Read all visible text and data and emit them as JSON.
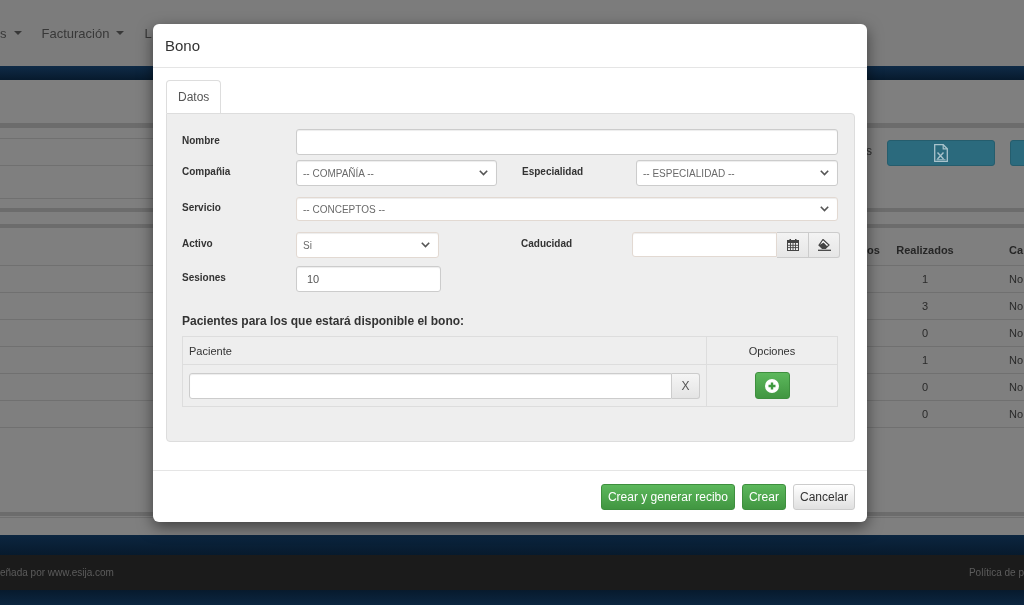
{
  "background": {
    "navbar": {
      "items": [
        {
          "label": "s",
          "dropdown": true
        },
        {
          "label": "Facturación",
          "dropdown": true
        },
        {
          "label": "L"
        }
      ]
    },
    "filter_panel": {
      "label": "s",
      "buttons": [
        {
          "kind": "export"
        },
        {
          "kind": "plain"
        }
      ]
    },
    "table": {
      "columns": [
        "os",
        "Realizados",
        "Ca"
      ],
      "rows": [
        {
          "realizados": "1",
          "column_3": "No"
        },
        {
          "realizados": "3",
          "column_3": "No"
        },
        {
          "realizados": "0",
          "column_3": "No"
        },
        {
          "realizados": "1",
          "column_3": "No"
        },
        {
          "realizados": "0",
          "column_3": "No"
        },
        {
          "realizados": "0",
          "column_3": "No"
        }
      ]
    },
    "footer": {
      "credit": "eñada por www.esija.com",
      "link": "Política de p"
    }
  },
  "dialog": {
    "title": "Bono",
    "tabs": [
      {
        "label": "Datos",
        "selected": true
      }
    ],
    "form_rows": [
      {
        "fields": [
          {
            "label": "Nombre",
            "kind": "text"
          }
        ]
      },
      {
        "fields": [
          {
            "label": "Compañia",
            "kind": "select",
            "value": "-- COMPAÑÍA --"
          },
          {
            "label": "Especialidad",
            "kind": "select",
            "value": "-- ESPECIALIDAD --"
          }
        ]
      },
      {
        "fields": [
          {
            "label": "Servicio",
            "kind": "select",
            "value": "-- CONCEPTOS --"
          }
        ]
      },
      {
        "fields": [
          {
            "label": "Activo",
            "kind": "select",
            "value": "Si"
          },
          {
            "label": "Caducidad",
            "kind": "date"
          }
        ]
      },
      {
        "fields": [
          {
            "label": "Sesiones",
            "kind": "text",
            "value": "10"
          }
        ]
      }
    ],
    "patients": {
      "heading": "Pacientes para los que estará disponible el bono:",
      "columns": [
        "Paciente",
        "Opciones"
      ],
      "clear_button": "X"
    },
    "buttons": [
      {
        "label": "Crear y generar recibo",
        "kind": "primary"
      },
      {
        "label": "Crear",
        "kind": "primary"
      },
      {
        "label": "Cancelar",
        "kind": "default"
      }
    ]
  }
}
